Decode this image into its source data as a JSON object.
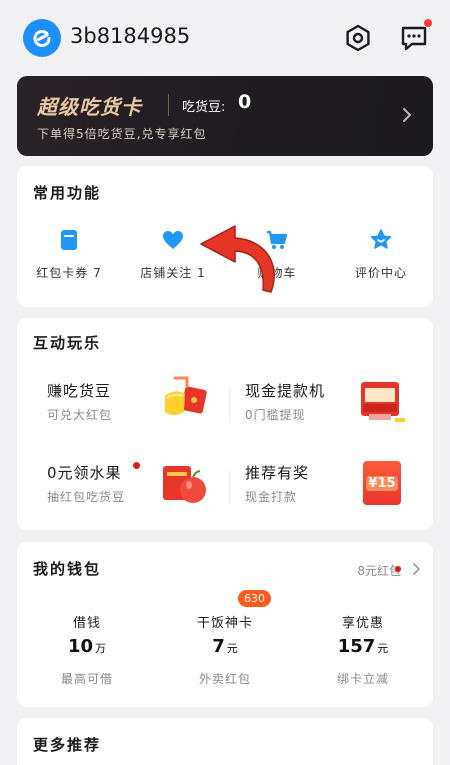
{
  "header": {
    "username": "3b8184985",
    "avatar_icon": "eleme-logo-icon",
    "settings_icon": "settings-icon",
    "message_icon": "message-icon"
  },
  "vip": {
    "title": "超级吃货卡",
    "beans_label": "吃货豆:",
    "beans_value": "0",
    "subtitle": "下单得5倍吃货豆,兑专享红包"
  },
  "common": {
    "title": "常用功能",
    "items": [
      {
        "label": "红包卡券 7",
        "icon": "coupon-icon"
      },
      {
        "label": "店铺关注 1",
        "icon": "heart-icon"
      },
      {
        "label": "购物车",
        "icon": "shopping-cart-icon"
      },
      {
        "label": "评价中心",
        "icon": "star-smile-icon"
      }
    ]
  },
  "interactive": {
    "title": "互动玩乐",
    "items": [
      {
        "title": "赚吃货豆",
        "subtitle": "可兑大红包"
      },
      {
        "title": "现金提款机",
        "subtitle": "0门槛提现"
      },
      {
        "title": "0元领水果",
        "subtitle": "抽红包吃货豆"
      },
      {
        "title": "推荐有奖",
        "subtitle": "现金打款"
      }
    ],
    "referral_badge": "¥15"
  },
  "wallet": {
    "title": "我的钱包",
    "link": "8元红包",
    "columns": [
      {
        "label": "借钱",
        "value": "10",
        "unit": "万",
        "sub": "最高可借"
      },
      {
        "label": "干饭神卡",
        "value": "7",
        "unit": "元",
        "sub": "外卖红包",
        "badge": "630"
      },
      {
        "label": "享优惠",
        "value": "157",
        "unit": "元",
        "sub": "绑卡立减"
      }
    ]
  },
  "more": {
    "title": "更多推荐"
  },
  "colors": {
    "accent_blue": "#1e8fff",
    "vip_gold": "#e9c8a3",
    "red": "#e61919",
    "annotation_red": "#e53524"
  }
}
